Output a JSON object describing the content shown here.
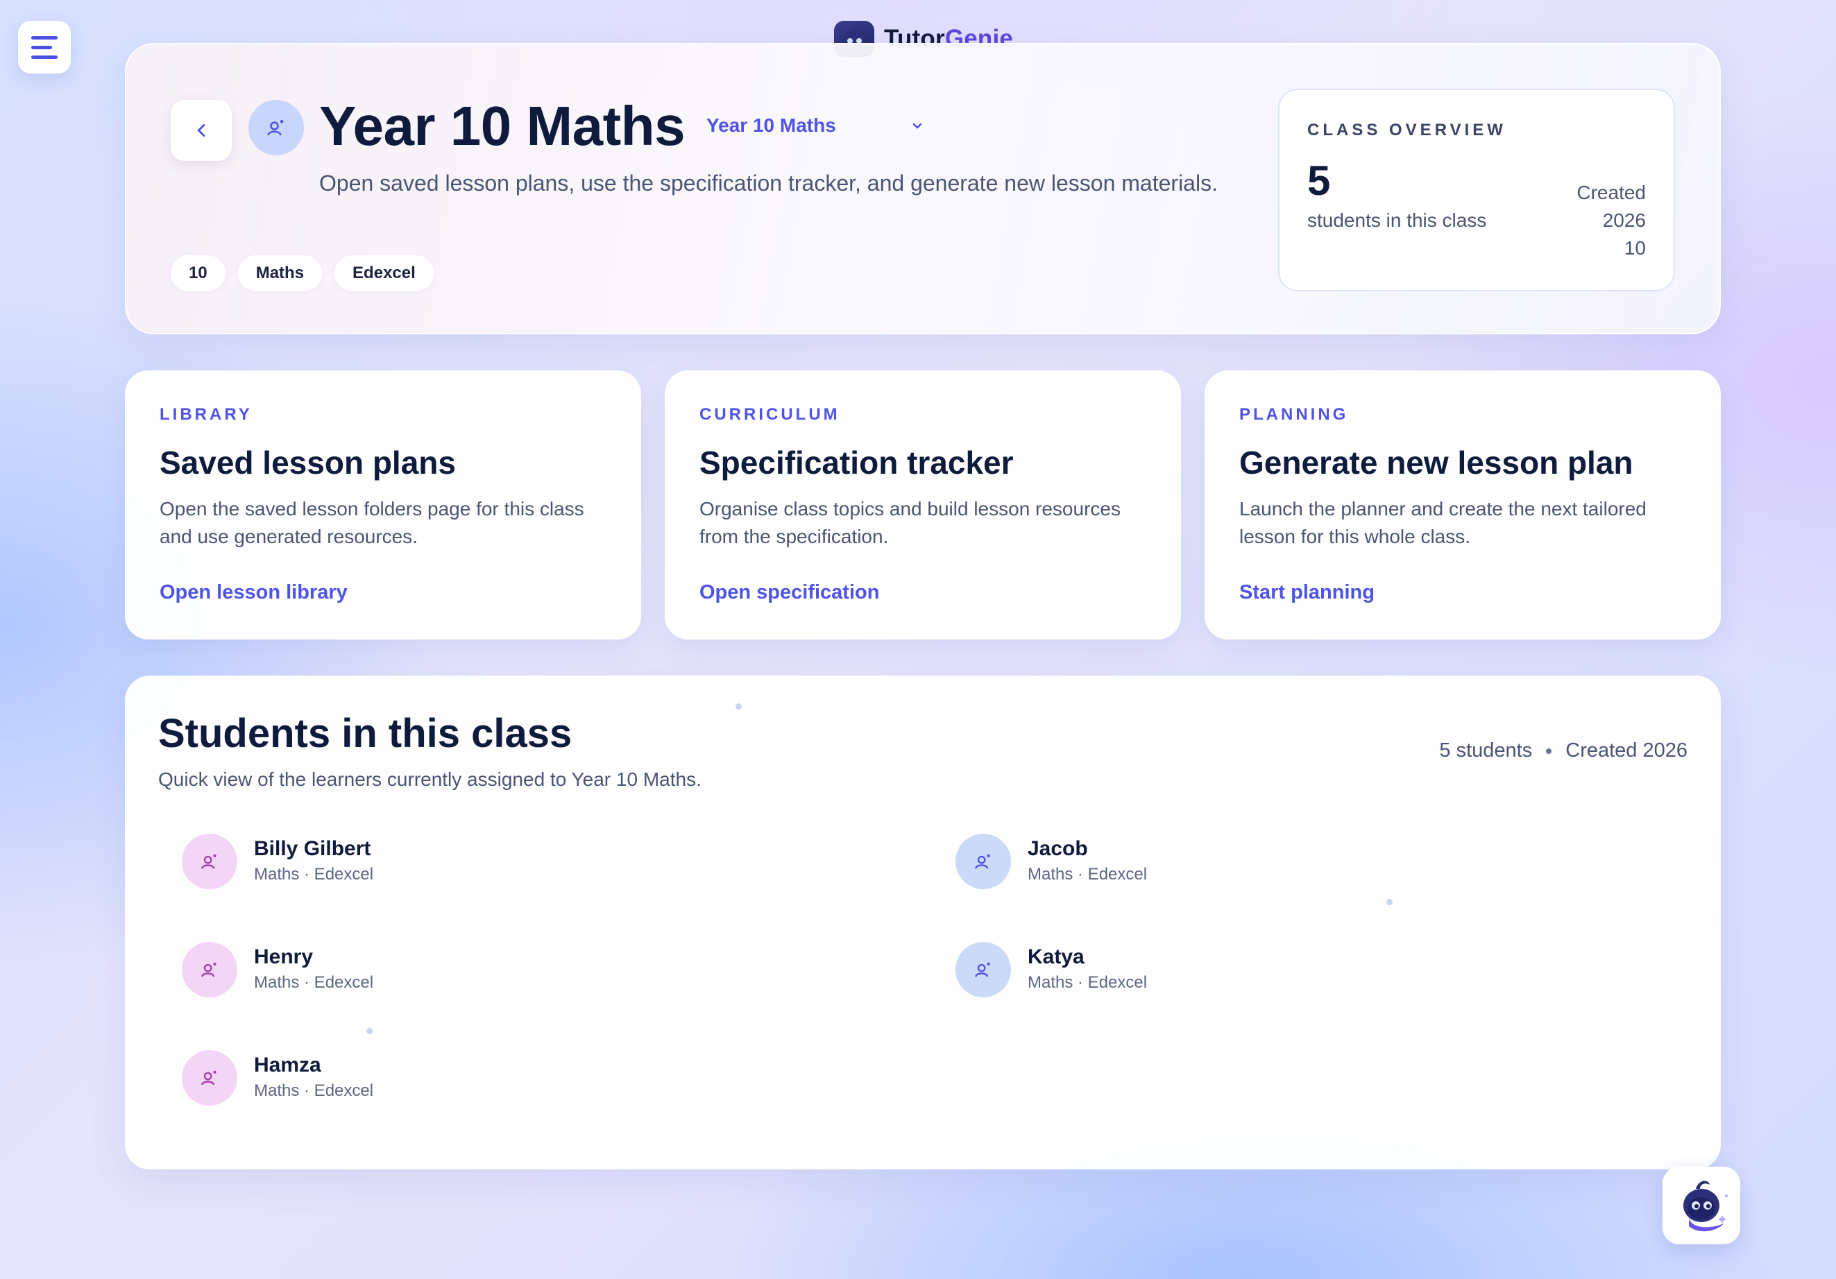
{
  "app": {
    "brand_primary": "Tutor",
    "brand_accent": "Genie",
    "brand_icon": "genie-mascot-icon"
  },
  "colors": {
    "accent": "#4f53e5",
    "brand_accent": "#5a47d8",
    "heading": "#0f1b3d",
    "body_text": "#4a5573",
    "avatar_pink": "#f3d6f6",
    "avatar_blue": "#ccdaf9"
  },
  "nav": {
    "menu_icon": "hamburger-menu-icon",
    "back_icon": "chevron-left-icon"
  },
  "hero": {
    "title": "Year 10 Maths",
    "class_select": {
      "selected": "Year 10 Maths",
      "icon": "chevron-down-icon"
    },
    "description": "Open saved lesson plans, use the specification tracker, and generate new lesson materials.",
    "tags": [
      "10",
      "Maths",
      "Edexcel"
    ]
  },
  "overview": {
    "eyebrow": "CLASS OVERVIEW",
    "count": "5",
    "count_label": "students in this class",
    "meta_lines": [
      "Created",
      "2026",
      "10"
    ]
  },
  "cards": [
    {
      "eyebrow": "LIBRARY",
      "title": "Saved lesson plans",
      "description": "Open the saved lesson folders page for this class and use generated resources.",
      "link": "Open lesson library"
    },
    {
      "eyebrow": "CURRICULUM",
      "title": "Specification tracker",
      "description": "Organise class topics and build lesson resources from the specification.",
      "link": "Open specification"
    },
    {
      "eyebrow": "PLANNING",
      "title": "Generate new lesson plan",
      "description": "Launch the planner and create the next tailored lesson for this whole class.",
      "link": "Start planning"
    }
  ],
  "students_section": {
    "title": "Students in this class",
    "subtitle": "Quick view of the learners currently assigned to Year 10 Maths.",
    "count_label": "5 students",
    "created_label": "Created 2026",
    "students": [
      {
        "name": "Billy Gilbert",
        "detail": "Maths · Edexcel",
        "avatar_color": "pink"
      },
      {
        "name": "Jacob",
        "detail": "Maths · Edexcel",
        "avatar_color": "blue"
      },
      {
        "name": "Henry",
        "detail": "Maths · Edexcel",
        "avatar_color": "pink"
      },
      {
        "name": "Katya",
        "detail": "Maths · Edexcel",
        "avatar_color": "blue"
      },
      {
        "name": "Hamza",
        "detail": "Maths · Edexcel",
        "avatar_color": "pink"
      }
    ]
  },
  "assistant": {
    "icon": "genie-assistant-icon"
  }
}
